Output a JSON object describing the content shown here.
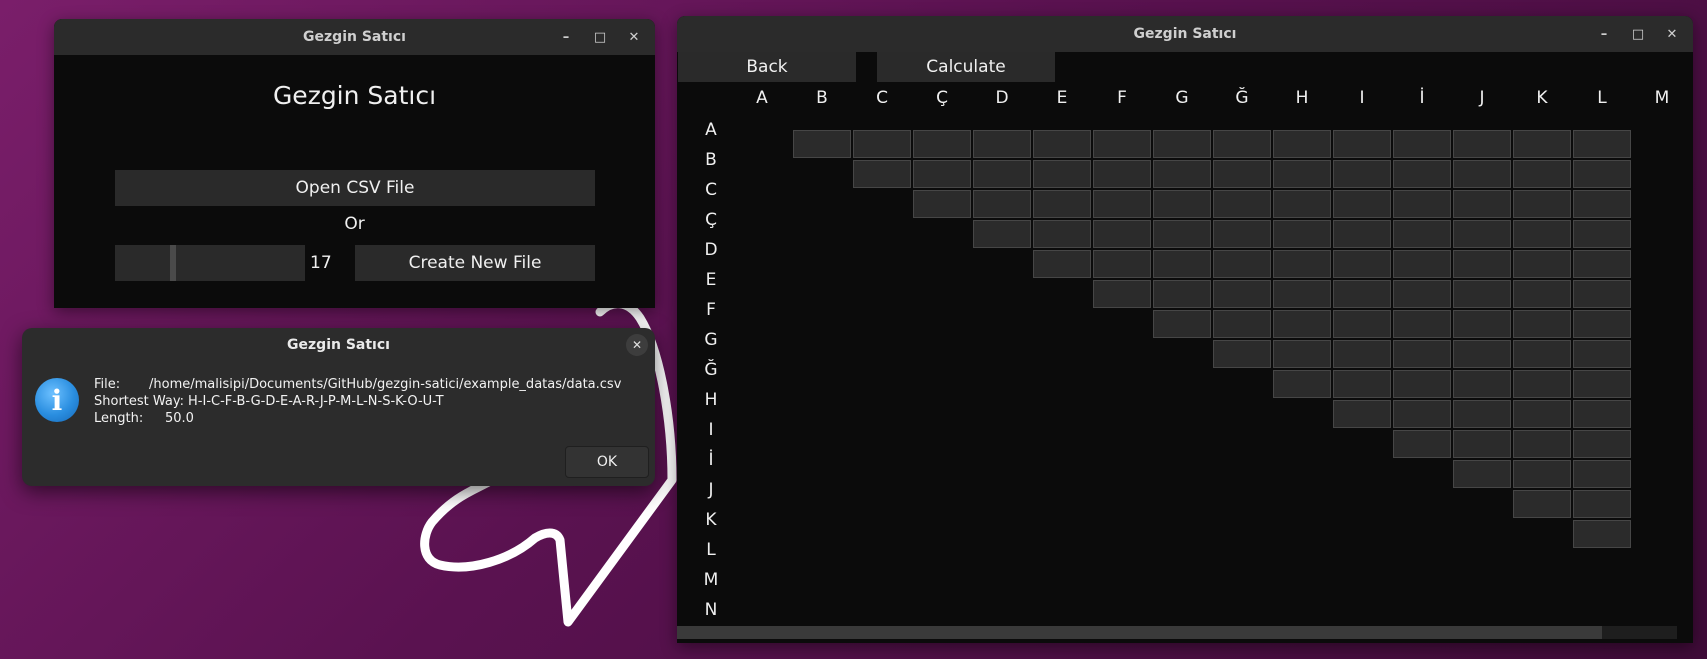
{
  "main_window": {
    "title": "Gezgin Satıcı",
    "heading": "Gezgin Satıcı",
    "open_csv_label": "Open CSV File",
    "or_label": "Or",
    "city_count_value": "17",
    "city_count_fraction": 0.3,
    "create_new_label": "Create New File",
    "controls": {
      "minimize": "–",
      "maximize": "□",
      "close": "✕"
    }
  },
  "dialog": {
    "title": "Gezgin Satıcı",
    "close_glyph": "✕",
    "icon": "info-icon",
    "icon_glyph": "i",
    "file_label": "File:",
    "file_value": "/home/malisipi/Documents/GitHub/gezgin-satici/example_datas/data.csv",
    "way_label": "Shortest Way:",
    "way_value": "H-I-C-F-B-G-D-E-A-R-J-P-M-L-N-S-K-O-U-T",
    "length_label": "Length:",
    "length_value": "50.0",
    "ok_label": "OK"
  },
  "matrix_window": {
    "title": "Gezgin Satıcı",
    "back_label": "Back",
    "calculate_label": "Calculate",
    "controls": {
      "minimize": "–",
      "maximize": "□",
      "close": "✕"
    },
    "column_headers": [
      "A",
      "B",
      "C",
      "Ç",
      "D",
      "E",
      "F",
      "G",
      "Ğ",
      "H",
      "I",
      "İ",
      "J",
      "K",
      "L",
      "M"
    ],
    "row_headers": [
      "A",
      "B",
      "C",
      "Ç",
      "D",
      "E",
      "F",
      "G",
      "Ğ",
      "H",
      "I",
      "İ",
      "J",
      "K",
      "L",
      "M",
      "N"
    ]
  }
}
